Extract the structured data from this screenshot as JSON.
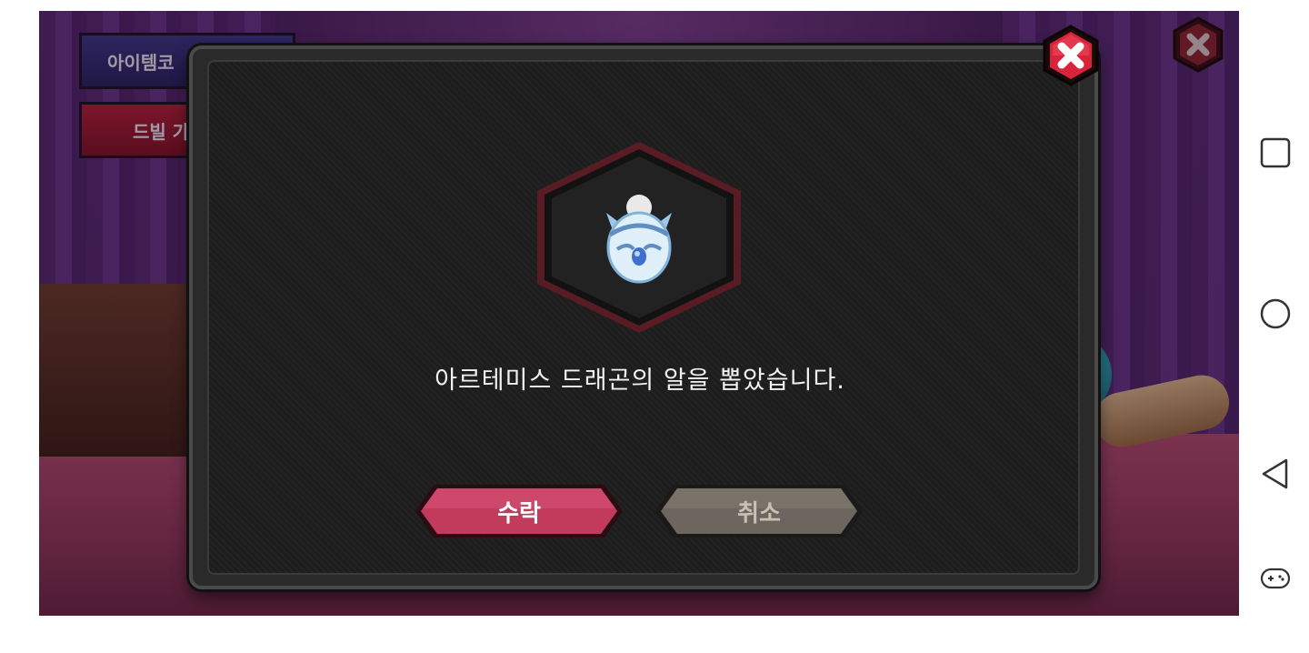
{
  "game": {
    "side_buttons": {
      "item_code_label": "아이템코",
      "dril_label": "드빌 가"
    }
  },
  "dialog": {
    "message": "아르테미스 드래곤의 알을 뽑았습니다.",
    "accept_label": "수락",
    "cancel_label": "취소",
    "item_icon": "artemis-dragon-egg-icon"
  },
  "colors": {
    "accept": "#c23a5c",
    "cancel": "#6d665e",
    "close_red": "#d8233a",
    "dialog_bg": "#1d1d1d"
  },
  "android_nav": {
    "icons": [
      "recent-apps-icon",
      "home-icon",
      "back-icon",
      "game-toolbar-icon"
    ]
  }
}
